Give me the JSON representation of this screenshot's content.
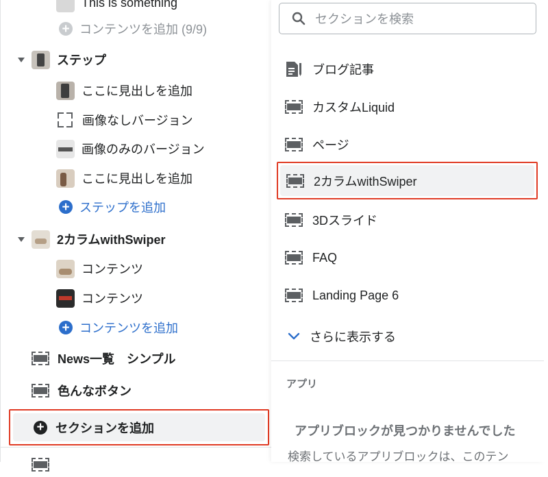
{
  "tree": {
    "top_partial": "This is something",
    "add_content_disabled": "コンテンツを追加 (9/9)",
    "step_section": "ステップ",
    "step_children": [
      "ここに見出しを追加",
      "画像なしバージョン",
      "画像のみのバージョン",
      "ここに見出しを追加"
    ],
    "add_step": "ステップを追加",
    "swiper_section": "2カラムwithSwiper",
    "swiper_children": [
      "コンテンツ",
      "コンテンツ"
    ],
    "add_content": "コンテンツを追加",
    "news_section": "News一覧　シンプル",
    "buttons_section": "色んなボタン",
    "add_section": "セクションを追加"
  },
  "popover": {
    "search_placeholder": "セクションを検索",
    "items": [
      {
        "label": "ブログ記事",
        "icon": "blog-post-icon"
      },
      {
        "label": "カスタムLiquid",
        "icon": "section-icon"
      },
      {
        "label": "ページ",
        "icon": "section-icon"
      },
      {
        "label": "2カラムwithSwiper",
        "icon": "section-icon"
      },
      {
        "label": "3Dスライド",
        "icon": "section-icon"
      },
      {
        "label": "FAQ",
        "icon": "section-icon"
      },
      {
        "label": "Landing Page 6",
        "icon": "section-icon"
      }
    ],
    "show_more": "さらに表示する",
    "apps_heading": "アプリ",
    "no_app_blocks_title": "アプリブロックが見つかりませんでした",
    "no_app_blocks_desc": "検索しているアプリブロックは、このテン"
  },
  "colors": {
    "accent_blue": "#2c6ecb",
    "highlight_border": "#e03b24",
    "highlight_bg": "#f1f2f3",
    "icon_grey": "#5c5f62"
  }
}
